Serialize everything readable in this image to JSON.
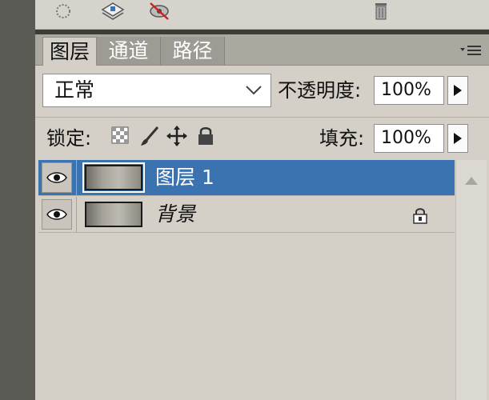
{
  "toolbar": {
    "icons": [
      "dotted-circle-icon",
      "adjustment-layer-icon",
      "red-eye-icon",
      "trash-icon"
    ]
  },
  "tabs": [
    {
      "label": "图层",
      "active": true
    },
    {
      "label": "通道",
      "active": false
    },
    {
      "label": "路径",
      "active": false
    }
  ],
  "blend": {
    "mode": "正常",
    "opacity_label": "不透明度:",
    "opacity_value": "100%"
  },
  "lock": {
    "label": "锁定:",
    "fill_label": "填充:",
    "fill_value": "100%",
    "icons": [
      "lock-transparency-icon",
      "lock-brush-icon",
      "lock-move-icon",
      "lock-all-icon"
    ]
  },
  "layers": [
    {
      "name": "图层 1",
      "selected": true,
      "visible": true,
      "locked": false
    },
    {
      "name": "背景",
      "selected": false,
      "visible": true,
      "locked": true
    }
  ],
  "colors": {
    "panel_bg": "#d4d0c8",
    "selected_row": "#3a73b0",
    "tab_bar": "#aaa89f"
  }
}
